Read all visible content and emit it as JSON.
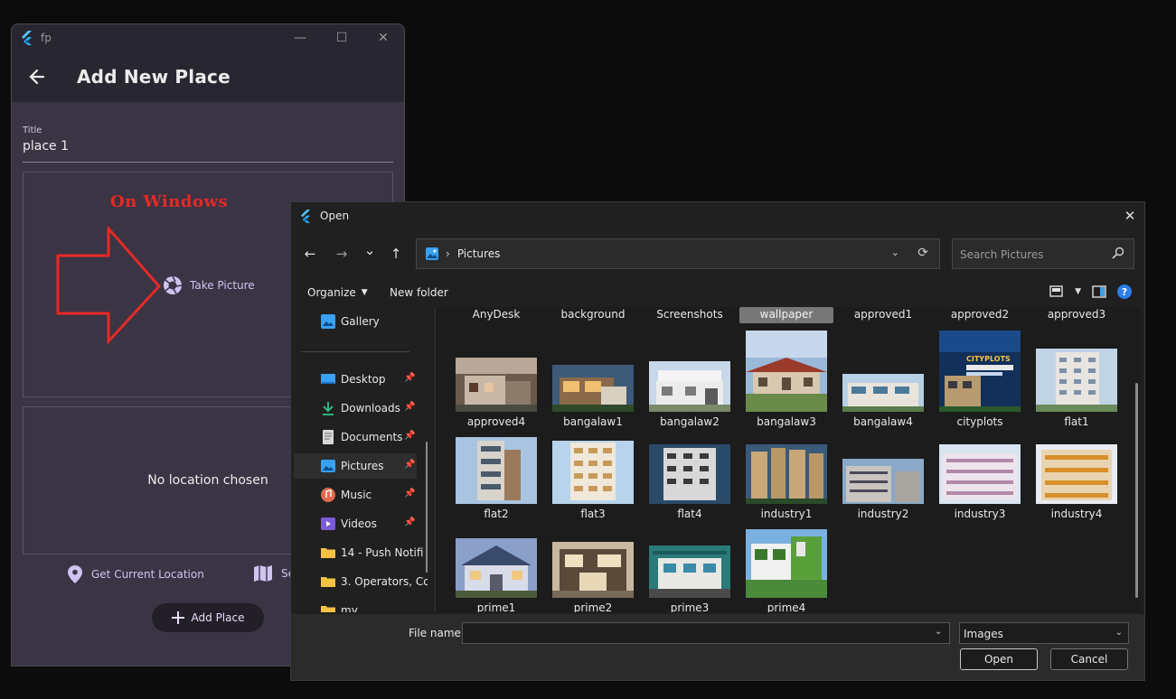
{
  "app": {
    "name": "fp",
    "window_controls": {
      "minimize": "—",
      "maximize": "☐",
      "close": "✕"
    },
    "page_title": "Add New Place",
    "title_field": {
      "label": "Title",
      "value": "place 1"
    },
    "annotation": "On Windows",
    "take_picture": "Take Picture",
    "no_location": "No location chosen",
    "get_location": "Get Current Location",
    "select_map": "Se",
    "add_place": "Add Place",
    "colors": {
      "background": "#3b3445",
      "appbar": "#282631",
      "accent": "#cfc3f0",
      "annotation": "#e42a25"
    }
  },
  "dialog": {
    "title": "Open",
    "close": "✕",
    "nav": {
      "back": "←",
      "forward": "→",
      "recent": "⌄",
      "up": "↑"
    },
    "address": {
      "crumb": "Pictures",
      "separator": "›"
    },
    "search_placeholder": "Search Pictures",
    "commands": {
      "organize": "Organize",
      "new_folder": "New folder",
      "help": "?"
    },
    "nav_items": [
      {
        "label": "Gallery",
        "icon": "gallery-icon",
        "pinned": false,
        "active": false
      },
      {
        "label": "Desktop",
        "icon": "desktop-icon",
        "pinned": true,
        "active": false
      },
      {
        "label": "Downloads",
        "icon": "download-icon",
        "pinned": true,
        "active": false
      },
      {
        "label": "Documents",
        "icon": "documents-icon",
        "pinned": true,
        "active": false
      },
      {
        "label": "Pictures",
        "icon": "pictures-icon",
        "pinned": true,
        "active": true
      },
      {
        "label": "Music",
        "icon": "music-icon",
        "pinned": true,
        "active": false
      },
      {
        "label": "Videos",
        "icon": "videos-icon",
        "pinned": true,
        "active": false
      },
      {
        "label": "14 - Push Notifi",
        "icon": "folder-icon",
        "pinned": false,
        "active": false
      },
      {
        "label": "3. Operators, Co",
        "icon": "folder-icon",
        "pinned": false,
        "active": false
      },
      {
        "label": "my",
        "icon": "folder-icon",
        "pinned": false,
        "active": false
      }
    ],
    "folder_row": [
      "AnyDesk",
      "background",
      "Screenshots",
      "wallpaper",
      "approved1",
      "approved2",
      "approved3"
    ],
    "selected_folder": "wallpaper",
    "files_row1": [
      "approved4",
      "bangalaw1",
      "bangalaw2",
      "bangalaw3",
      "bangalaw4",
      "cityplots",
      "flat1"
    ],
    "files_row2": [
      "flat2",
      "flat3",
      "flat4",
      "industry1",
      "industry2",
      "industry3",
      "industry4"
    ],
    "files_row3": [
      "prime1",
      "prime2",
      "prime3",
      "prime4"
    ],
    "cityplots_text": "CITYPLOTS",
    "file_name_label": "File name:",
    "file_name_value": "",
    "file_type": "Images",
    "open_label": "Open",
    "cancel_label": "Cancel",
    "colors": {
      "accent": "#2b7de9",
      "selection": "#777777"
    }
  }
}
